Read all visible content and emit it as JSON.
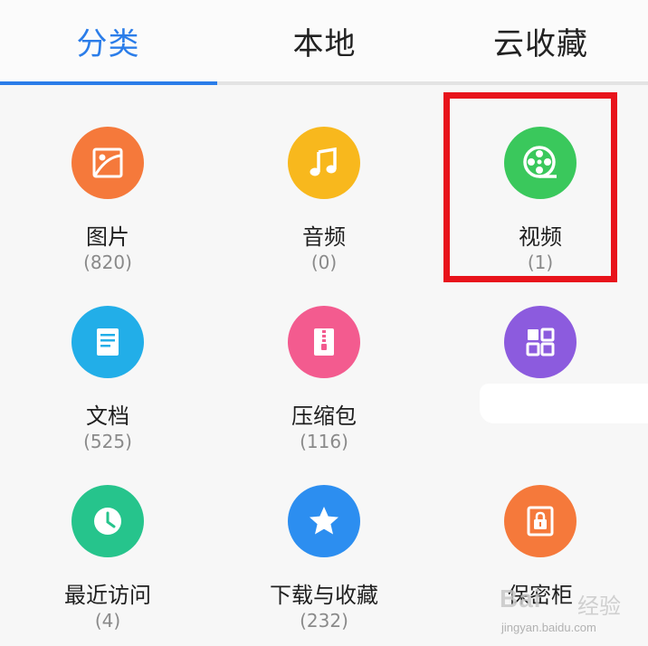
{
  "tabs": [
    {
      "label": "分类",
      "active": true
    },
    {
      "label": "本地",
      "active": false
    },
    {
      "label": "云收藏",
      "active": false
    }
  ],
  "colors": {
    "accent": "#2b7de9",
    "highlight": "#e8131b"
  },
  "categories": [
    {
      "label": "图片",
      "count": "(820)",
      "icon": "image-icon",
      "color": "#f5793b"
    },
    {
      "label": "音频",
      "count": "(0)",
      "icon": "music-note-icon",
      "color": "#f8b81d"
    },
    {
      "label": "视频",
      "count": "(1)",
      "icon": "film-reel-icon",
      "color": "#3ac85c",
      "highlighted": true
    },
    {
      "label": "文档",
      "count": "(525)",
      "icon": "document-icon",
      "color": "#22aee8"
    },
    {
      "label": "压缩包",
      "count": "(116)",
      "icon": "zip-archive-icon",
      "color": "#f35b8f"
    },
    {
      "label": "",
      "count": "",
      "icon": "apps-grid-icon",
      "color": "#8c5bde"
    },
    {
      "label": "最近访问",
      "count": "(4)",
      "icon": "clock-icon",
      "color": "#26c48c"
    },
    {
      "label": "下载与收藏",
      "count": "(232)",
      "icon": "star-icon",
      "color": "#2c8ef0"
    },
    {
      "label": "保密柜",
      "count": "",
      "icon": "safe-lock-icon",
      "color": "#f5793b"
    }
  ],
  "watermark": {
    "logo": "Bai",
    "logo_suffix": "经验",
    "url": "jingyan.baidu.com"
  }
}
